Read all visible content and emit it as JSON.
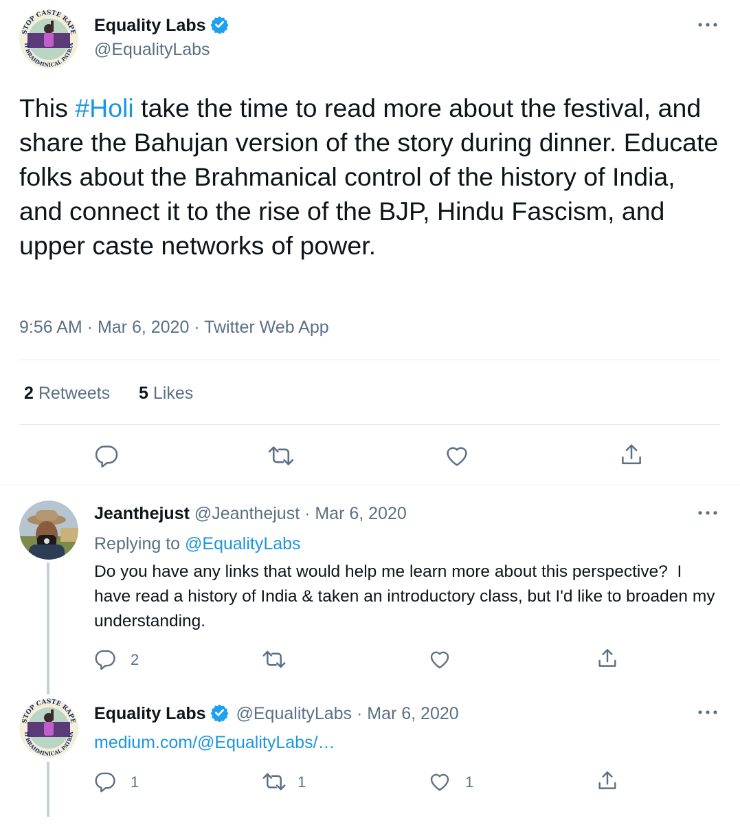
{
  "main_tweet": {
    "author_name": "Equality Labs",
    "author_handle": "@EqualityLabs",
    "avatar_text_top": "STOP CASTE RAPE",
    "avatar_text_bottom": "SMASH BRAHMINICAL PATRIARCHY",
    "text_before_hashtag": "This ",
    "hashtag": "#Holi",
    "text_after_hashtag": " take the time to read more about the festival, and share the Bahujan version of the story during dinner. Educate folks about the Brahmanical control of the history of India, and connect it to the rise of the BJP, Hindu Fascism, and upper caste networks of power.",
    "timestamp": "9:56 AM · Mar 6, 2020 · Twitter Web App",
    "retweets_count": "2",
    "retweets_label": "Retweets",
    "likes_count": "5",
    "likes_label": "Likes"
  },
  "reply_1": {
    "author_name": "Jeanthejust",
    "meta": "@Jeanthejust · Mar 6, 2020",
    "replying_prefix": "Replying to ",
    "replying_to": "@EqualityLabs",
    "text": "Do you have any links that would help me learn more about this perspective?  I have read a history of India & taken an introductory class, but I'd like to broaden my understanding.",
    "reply_count": "2",
    "retweet_count": "",
    "like_count": ""
  },
  "reply_2": {
    "author_name": "Equality Labs",
    "meta": "@EqualityLabs · Mar 6, 2020",
    "link_text": "medium.com/@EqualityLabs/…",
    "reply_count": "1",
    "retweet_count": "1",
    "like_count": "1"
  },
  "colors": {
    "link": "#1b95e0",
    "secondary_text": "#5b7083",
    "verified": "#1da1f2",
    "divider": "#e6ecf0"
  },
  "icons": [
    "reply-icon",
    "retweet-icon",
    "like-icon",
    "share-icon",
    "more-icon",
    "verified-badge-icon"
  ]
}
